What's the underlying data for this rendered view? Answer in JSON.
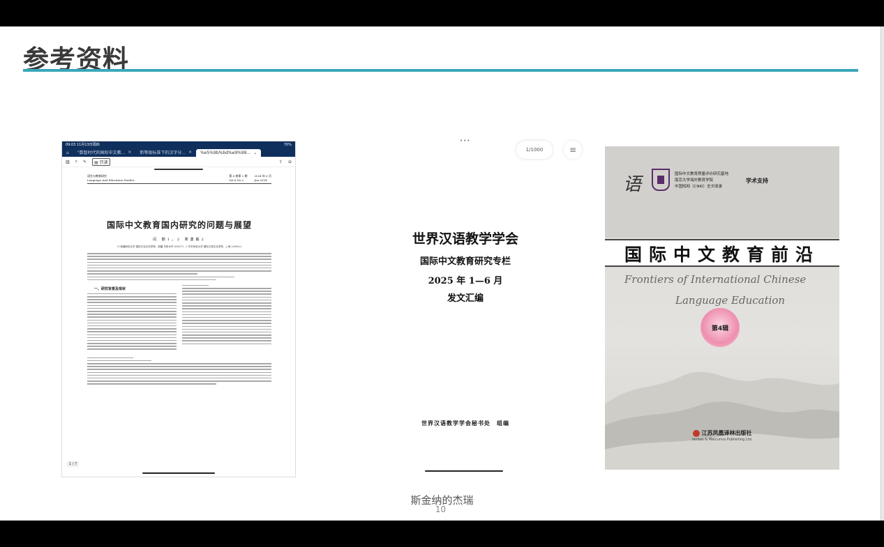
{
  "slide": {
    "title": "参考资料",
    "author": "斯金纳的杰瑞",
    "page_number": "10",
    "accent_color": "#3aa6b9"
  },
  "ipad": {
    "status_time": "09:03  11月13日周四",
    "status_battery": "70%",
    "tabs": [
      {
        "label": "\"数智时代的国际中文教..."
      },
      {
        "label": "新等级标准下的汉字分..."
      },
      {
        "label": "%e5%9b%bd%e9%99..."
      }
    ],
    "readonly_label": "只读",
    "pdf": {
      "journal_cn": "语言与教育研究",
      "journal_en": "Language And Education Studies",
      "volume": "第 8 卷第 2 期",
      "volume_en": "Vol.8  No.2",
      "date": "2024 年 6 月",
      "date_en": "Jun.2024",
      "title": "国际中文教育国内研究的问题与展望",
      "authors": "闫  丽1，2    吴勇毅2",
      "affiliation": "（1.新疆师范大学 国际文化交流学院，新疆 乌鲁木齐 830017；2.华东师范大学 国际汉语文化学院，上海 200062）",
      "section_heading": "一、研究背景及现状",
      "page_indicator": "1 / 7"
    }
  },
  "doc": {
    "page_counter": "1/1000",
    "line1": "世界汉语教学学会",
    "line2": "国际中文教育研究专栏",
    "line3": "2025 年 1—6 月",
    "line4": "发文汇编",
    "footer": "世界汉语教学学会秘书处　组编"
  },
  "cover": {
    "calligraphy": "语",
    "sponsor_lines": [
      "国际中文教育质量评价研究基地",
      "南京大学海外教育学院",
      "中国知网（CNKI）全文收录"
    ],
    "support": "学术支持",
    "title_cn": "国际中文教育前沿",
    "title_en_1": "Frontiers of International Chinese",
    "title_en_2": "Language Education",
    "issue": "第4辑",
    "publisher_cn": "江苏凤凰译林出版社",
    "publisher_en": "Verbas & Mercurius Publishing Ltd."
  }
}
